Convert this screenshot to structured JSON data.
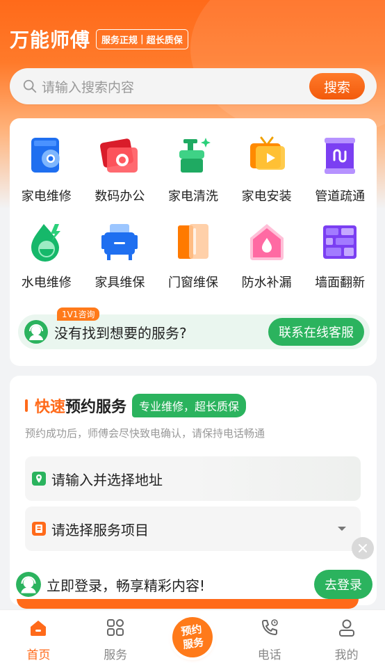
{
  "header": {
    "title": "万能师傅",
    "tag_left": "服务正规",
    "tag_sep": "|",
    "tag_right": "超长质保"
  },
  "search": {
    "placeholder": "请输入搜索内容",
    "button_label": "搜索"
  },
  "services": [
    {
      "label": "家电维修",
      "icon": "washing-machine-icon"
    },
    {
      "label": "数码办公",
      "icon": "camera-icon"
    },
    {
      "label": "家电清洗",
      "icon": "cleaning-spray-icon"
    },
    {
      "label": "家电安装",
      "icon": "tv-icon"
    },
    {
      "label": "管道疏通",
      "icon": "pipe-icon"
    },
    {
      "label": "水电维修",
      "icon": "water-electric-icon"
    },
    {
      "label": "家具维保",
      "icon": "furniture-icon"
    },
    {
      "label": "门窗维保",
      "icon": "door-window-icon"
    },
    {
      "label": "防水补漏",
      "icon": "waterproof-house-icon"
    },
    {
      "label": "墙面翻新",
      "icon": "brick-wall-icon"
    }
  ],
  "consult": {
    "badge": "1V1咨询",
    "text": "没有找到想要的服务?",
    "button_label": "联系在线客服"
  },
  "booking": {
    "title_highlight": "快速",
    "title_rest": "预约服务",
    "tag": "专业维修，超长质保",
    "subtitle": "预约成功后，师傅会尽快致电确认，请保持电话畅通",
    "address_placeholder": "请输入并选择地址",
    "project_placeholder": "请选择服务项目"
  },
  "login_prompt": {
    "text": "立即登录，畅享精彩内容!",
    "button_label": "去登录"
  },
  "tabbar": {
    "home": "首页",
    "services": "服务",
    "book_line1": "预约",
    "book_line2": "服务",
    "phone": "电话",
    "mine": "我的"
  },
  "colors": {
    "brand_orange": "#ff6a1a",
    "accent_green": "#2bb35e"
  }
}
